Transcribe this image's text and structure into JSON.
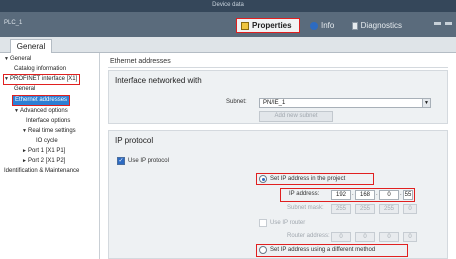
{
  "window": {
    "title": "Device data",
    "device_name": "PLC_1"
  },
  "header_tabs": [
    {
      "label": "Properties",
      "icon": "properties-icon"
    },
    {
      "label": "Info",
      "icon": "info-icon"
    },
    {
      "label": "Diagnostics",
      "icon": "diagnostics-icon"
    }
  ],
  "subtabs": {
    "general": "General"
  },
  "nav": {
    "general": "General",
    "catalog": "Catalog information",
    "profinet": "PROFINET interface [X1]",
    "profinet_general": "General",
    "ethernet": "Ethernet addresses",
    "advanced": "Advanced options",
    "interface_options": "Interface options",
    "realtime": "Real time settings",
    "io_cycle": "IO cycle",
    "port1": "Port 1 [X1 P1]",
    "port2": "Port 2 [X1 P2]",
    "identification": "Identification & Maintenance"
  },
  "content": {
    "section_title": "Ethernet addresses",
    "interface_box": {
      "title": "Interface networked with",
      "subnet_label": "Subnet:",
      "subnet_value": "PN/IE_1",
      "add_subnet": "Add new subnet"
    },
    "ip_box": {
      "title": "IP protocol",
      "use_ip": "Use IP protocol",
      "set_in_project": "Set IP address in the project",
      "ip_label": "IP address:",
      "ip": [
        "192",
        "168",
        "0",
        "55"
      ],
      "subnet_mask_label": "Subnet mask:",
      "subnet_mask": [
        "255",
        "255",
        "255",
        "0"
      ],
      "use_router": "Use IP router",
      "router_label": "Router address:",
      "router": [
        "0",
        "0",
        "0",
        "0"
      ],
      "set_different": "Set IP address using a different method"
    }
  },
  "colors": {
    "highlight": "#e02020",
    "selection": "#2d7fd4",
    "header": "#5a6b7c"
  }
}
